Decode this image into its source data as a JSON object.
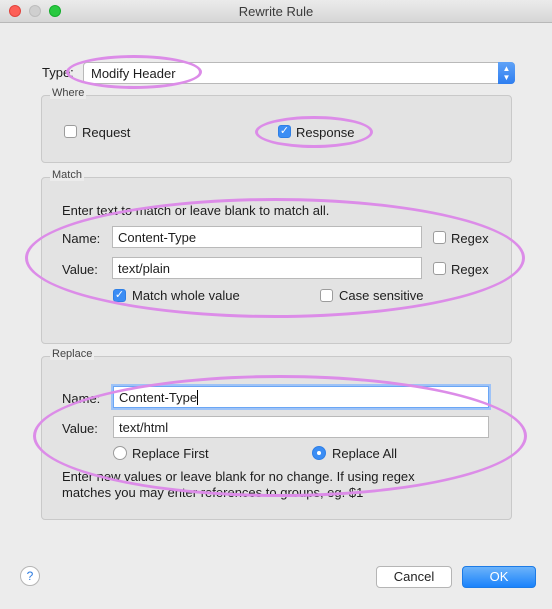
{
  "window": {
    "title": "Rewrite Rule"
  },
  "type": {
    "label": "Type:",
    "value": "Modify Header"
  },
  "where": {
    "title": "Where",
    "request": {
      "label": "Request",
      "checked": false
    },
    "response": {
      "label": "Response",
      "checked": true
    }
  },
  "match": {
    "title": "Match",
    "instruction": "Enter text to match or leave blank to match all.",
    "name_label": "Name:",
    "name_value": "Content-Type",
    "value_label": "Value:",
    "value_value": "text/plain",
    "regex_label": "Regex",
    "regex2_label": "Regex",
    "whole_value_label": "Match whole value",
    "case_sensitive_label": "Case sensitive"
  },
  "replace": {
    "title": "Replace",
    "name_label": "Name:",
    "name_value": "Content-Type",
    "value_label": "Value:",
    "value_value": "text/html",
    "replace_first_label": "Replace First",
    "replace_all_label": "Replace All",
    "note_line1": "Enter new values or leave blank for no change. If using regex",
    "note_line2": "matches you may enter references to groups, eg. $1"
  },
  "buttons": {
    "help": "?",
    "cancel": "Cancel",
    "ok": "OK"
  },
  "annotation_color": "#dc8ce8"
}
